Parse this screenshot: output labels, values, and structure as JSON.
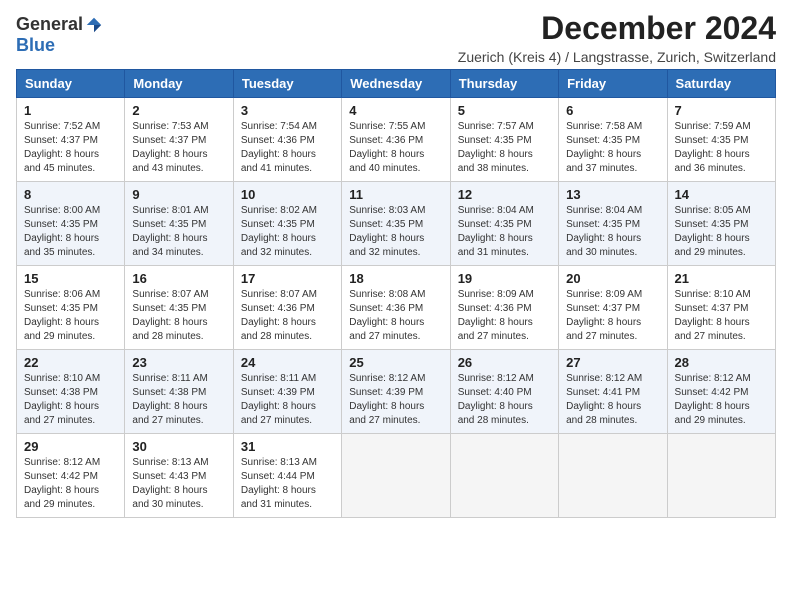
{
  "logo": {
    "general": "General",
    "blue": "Blue"
  },
  "header": {
    "month": "December 2024",
    "subtitle": "Zuerich (Kreis 4) / Langstrasse, Zurich, Switzerland"
  },
  "weekdays": [
    "Sunday",
    "Monday",
    "Tuesday",
    "Wednesday",
    "Thursday",
    "Friday",
    "Saturday"
  ],
  "weeks": [
    [
      {
        "day": "1",
        "sunrise": "Sunrise: 7:52 AM",
        "sunset": "Sunset: 4:37 PM",
        "daylight": "Daylight: 8 hours and 45 minutes."
      },
      {
        "day": "2",
        "sunrise": "Sunrise: 7:53 AM",
        "sunset": "Sunset: 4:37 PM",
        "daylight": "Daylight: 8 hours and 43 minutes."
      },
      {
        "day": "3",
        "sunrise": "Sunrise: 7:54 AM",
        "sunset": "Sunset: 4:36 PM",
        "daylight": "Daylight: 8 hours and 41 minutes."
      },
      {
        "day": "4",
        "sunrise": "Sunrise: 7:55 AM",
        "sunset": "Sunset: 4:36 PM",
        "daylight": "Daylight: 8 hours and 40 minutes."
      },
      {
        "day": "5",
        "sunrise": "Sunrise: 7:57 AM",
        "sunset": "Sunset: 4:35 PM",
        "daylight": "Daylight: 8 hours and 38 minutes."
      },
      {
        "day": "6",
        "sunrise": "Sunrise: 7:58 AM",
        "sunset": "Sunset: 4:35 PM",
        "daylight": "Daylight: 8 hours and 37 minutes."
      },
      {
        "day": "7",
        "sunrise": "Sunrise: 7:59 AM",
        "sunset": "Sunset: 4:35 PM",
        "daylight": "Daylight: 8 hours and 36 minutes."
      }
    ],
    [
      {
        "day": "8",
        "sunrise": "Sunrise: 8:00 AM",
        "sunset": "Sunset: 4:35 PM",
        "daylight": "Daylight: 8 hours and 35 minutes."
      },
      {
        "day": "9",
        "sunrise": "Sunrise: 8:01 AM",
        "sunset": "Sunset: 4:35 PM",
        "daylight": "Daylight: 8 hours and 34 minutes."
      },
      {
        "day": "10",
        "sunrise": "Sunrise: 8:02 AM",
        "sunset": "Sunset: 4:35 PM",
        "daylight": "Daylight: 8 hours and 32 minutes."
      },
      {
        "day": "11",
        "sunrise": "Sunrise: 8:03 AM",
        "sunset": "Sunset: 4:35 PM",
        "daylight": "Daylight: 8 hours and 32 minutes."
      },
      {
        "day": "12",
        "sunrise": "Sunrise: 8:04 AM",
        "sunset": "Sunset: 4:35 PM",
        "daylight": "Daylight: 8 hours and 31 minutes."
      },
      {
        "day": "13",
        "sunrise": "Sunrise: 8:04 AM",
        "sunset": "Sunset: 4:35 PM",
        "daylight": "Daylight: 8 hours and 30 minutes."
      },
      {
        "day": "14",
        "sunrise": "Sunrise: 8:05 AM",
        "sunset": "Sunset: 4:35 PM",
        "daylight": "Daylight: 8 hours and 29 minutes."
      }
    ],
    [
      {
        "day": "15",
        "sunrise": "Sunrise: 8:06 AM",
        "sunset": "Sunset: 4:35 PM",
        "daylight": "Daylight: 8 hours and 29 minutes."
      },
      {
        "day": "16",
        "sunrise": "Sunrise: 8:07 AM",
        "sunset": "Sunset: 4:35 PM",
        "daylight": "Daylight: 8 hours and 28 minutes."
      },
      {
        "day": "17",
        "sunrise": "Sunrise: 8:07 AM",
        "sunset": "Sunset: 4:36 PM",
        "daylight": "Daylight: 8 hours and 28 minutes."
      },
      {
        "day": "18",
        "sunrise": "Sunrise: 8:08 AM",
        "sunset": "Sunset: 4:36 PM",
        "daylight": "Daylight: 8 hours and 27 minutes."
      },
      {
        "day": "19",
        "sunrise": "Sunrise: 8:09 AM",
        "sunset": "Sunset: 4:36 PM",
        "daylight": "Daylight: 8 hours and 27 minutes."
      },
      {
        "day": "20",
        "sunrise": "Sunrise: 8:09 AM",
        "sunset": "Sunset: 4:37 PM",
        "daylight": "Daylight: 8 hours and 27 minutes."
      },
      {
        "day": "21",
        "sunrise": "Sunrise: 8:10 AM",
        "sunset": "Sunset: 4:37 PM",
        "daylight": "Daylight: 8 hours and 27 minutes."
      }
    ],
    [
      {
        "day": "22",
        "sunrise": "Sunrise: 8:10 AM",
        "sunset": "Sunset: 4:38 PM",
        "daylight": "Daylight: 8 hours and 27 minutes."
      },
      {
        "day": "23",
        "sunrise": "Sunrise: 8:11 AM",
        "sunset": "Sunset: 4:38 PM",
        "daylight": "Daylight: 8 hours and 27 minutes."
      },
      {
        "day": "24",
        "sunrise": "Sunrise: 8:11 AM",
        "sunset": "Sunset: 4:39 PM",
        "daylight": "Daylight: 8 hours and 27 minutes."
      },
      {
        "day": "25",
        "sunrise": "Sunrise: 8:12 AM",
        "sunset": "Sunset: 4:39 PM",
        "daylight": "Daylight: 8 hours and 27 minutes."
      },
      {
        "day": "26",
        "sunrise": "Sunrise: 8:12 AM",
        "sunset": "Sunset: 4:40 PM",
        "daylight": "Daylight: 8 hours and 28 minutes."
      },
      {
        "day": "27",
        "sunrise": "Sunrise: 8:12 AM",
        "sunset": "Sunset: 4:41 PM",
        "daylight": "Daylight: 8 hours and 28 minutes."
      },
      {
        "day": "28",
        "sunrise": "Sunrise: 8:12 AM",
        "sunset": "Sunset: 4:42 PM",
        "daylight": "Daylight: 8 hours and 29 minutes."
      }
    ],
    [
      {
        "day": "29",
        "sunrise": "Sunrise: 8:12 AM",
        "sunset": "Sunset: 4:42 PM",
        "daylight": "Daylight: 8 hours and 29 minutes."
      },
      {
        "day": "30",
        "sunrise": "Sunrise: 8:13 AM",
        "sunset": "Sunset: 4:43 PM",
        "daylight": "Daylight: 8 hours and 30 minutes."
      },
      {
        "day": "31",
        "sunrise": "Sunrise: 8:13 AM",
        "sunset": "Sunset: 4:44 PM",
        "daylight": "Daylight: 8 hours and 31 minutes."
      },
      null,
      null,
      null,
      null
    ]
  ]
}
